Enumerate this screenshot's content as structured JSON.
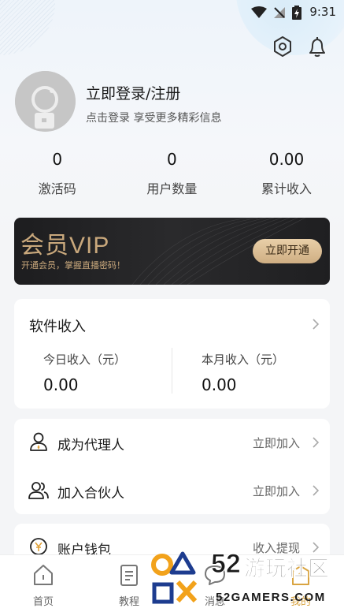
{
  "status": {
    "time": "9:31"
  },
  "profile": {
    "title": "立即登录/注册",
    "subtitle": "点击登录 享受更多精彩信息"
  },
  "stats": [
    {
      "value": "0",
      "label": "激活码"
    },
    {
      "value": "0",
      "label": "用户数量"
    },
    {
      "value": "0.00",
      "label": "累计收入"
    }
  ],
  "vip": {
    "title": "会员VIP",
    "subtitle": "开通会员，掌握直播密码！",
    "button": "立即开通"
  },
  "income": {
    "title": "软件收入",
    "today_label": "今日收入（元）",
    "today_value": "0.00",
    "month_label": "本月收入（元）",
    "month_value": "0.00"
  },
  "rows": {
    "agent": {
      "label": "成为代理人",
      "action": "立即加入"
    },
    "partner": {
      "label": "加入合伙人",
      "action": "立即加入"
    },
    "wallet": {
      "label": "账户钱包",
      "action": "收入提现"
    }
  },
  "nav": {
    "home": "首页",
    "tutorial": "教程",
    "message": "消息",
    "mine": "我的"
  },
  "watermark": {
    "number": "52",
    "text": "游玩社区",
    "domain": "52GAMERS.COM"
  },
  "colors": {
    "accent": "#d9a441",
    "vip_gold": "#c9a87c"
  }
}
